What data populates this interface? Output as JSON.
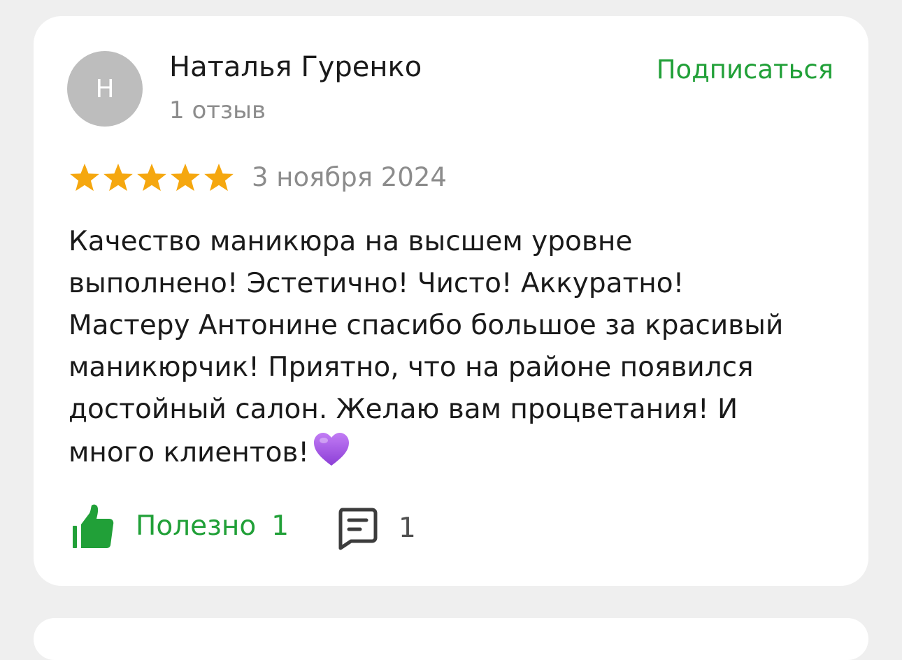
{
  "review": {
    "author": {
      "initial": "Н",
      "name": "Наталья Гуренко",
      "reviews_count": "1 отзыв"
    },
    "subscribe_label": "Подписаться",
    "rating": 5,
    "rating_max": 5,
    "date": "3 ноября 2024",
    "text": "Качество маникюра на высшем уровне\nвыполнено! Эстетично! Чисто! Аккуратно!\nМастеру Антонине спасибо большое за красивый\nманикюрчик! Приятно, что на районе появился\nдостойный салон. Желаю вам процветания! И\nмного клиентов!",
    "emoji": "purple-heart-icon",
    "useful_label": "Полезно",
    "useful_count": "1",
    "comments_count": "1"
  },
  "colors": {
    "accent_green": "#21a038",
    "star_gold": "#f5a70f",
    "muted_text": "#8c8c8c",
    "avatar_bg": "#bdbdbd",
    "heart_purple": "#a55be3"
  },
  "icons": {
    "star": "star-icon",
    "thumb": "thumbs-up-icon",
    "comment": "comment-icon"
  }
}
